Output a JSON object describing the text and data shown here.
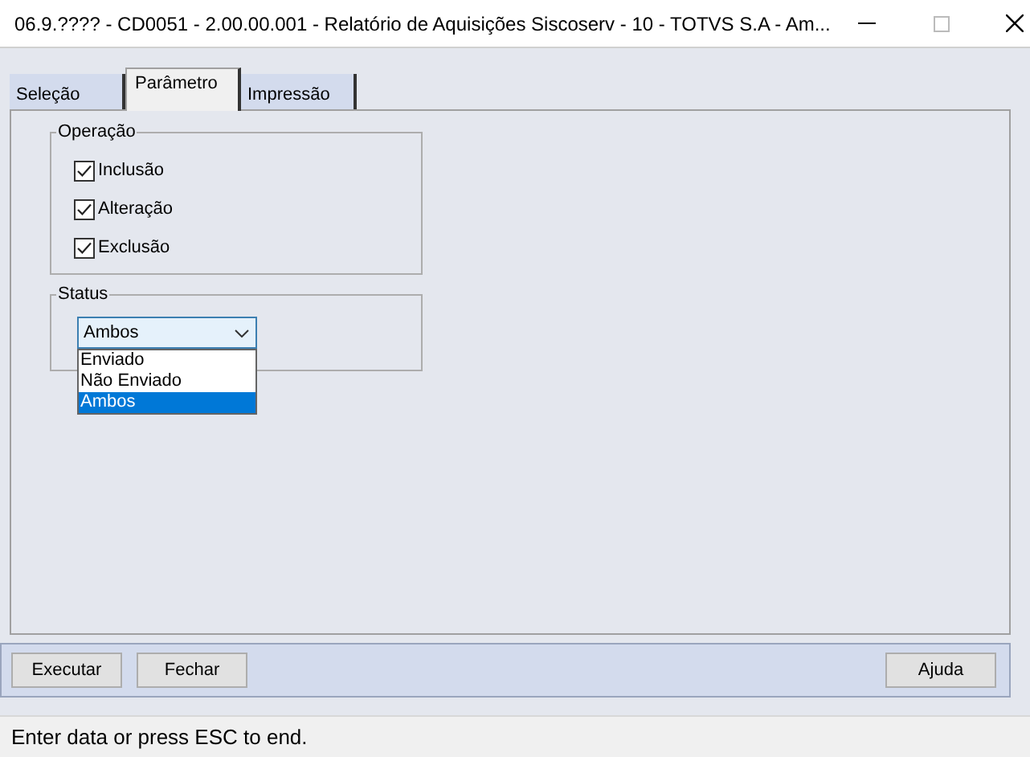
{
  "window": {
    "title": "06.9.???? - CD0051 - 2.00.00.001 - Relatório de Aquisições Siscoserv - 10 - TOTVS S.A - Am..."
  },
  "tabs": [
    {
      "label": "Seleção",
      "selected": false
    },
    {
      "label": "Parâmetro",
      "selected": true
    },
    {
      "label": "Impressão",
      "selected": false
    }
  ],
  "operacao": {
    "title": "Operação",
    "options": [
      {
        "label": "Inclusão",
        "checked": true
      },
      {
        "label": "Alteração",
        "checked": true
      },
      {
        "label": "Exclusão",
        "checked": true
      }
    ]
  },
  "status": {
    "title": "Status",
    "value": "Ambos",
    "expanded": true,
    "options": [
      {
        "label": "Enviado",
        "selected": false
      },
      {
        "label": "Não Enviado",
        "selected": false
      },
      {
        "label": "Ambos",
        "selected": true
      }
    ]
  },
  "buttons_left": [
    "Executar",
    "Fechar"
  ],
  "buttons_right": [
    "Ajuda"
  ],
  "status_bar": "Enter data or press ESC to end."
}
